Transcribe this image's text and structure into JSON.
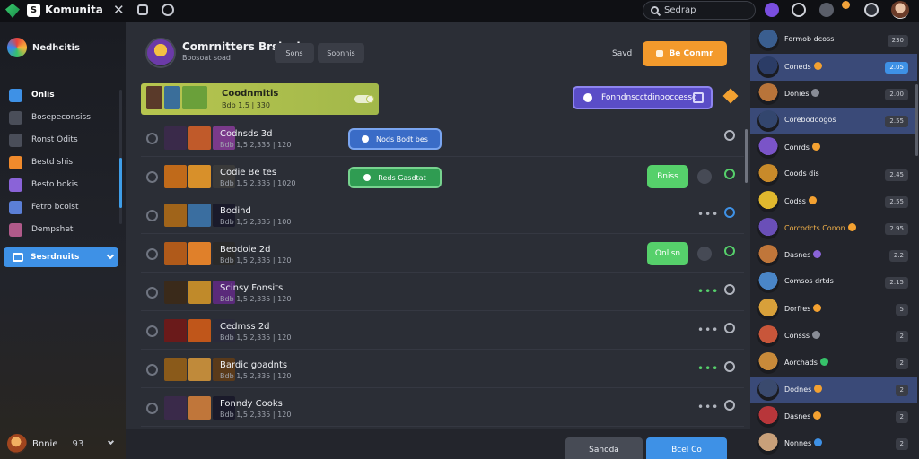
{
  "titlebar": {
    "title": "Komunita",
    "search_placeholder": "Sedrap"
  },
  "sidebar": {
    "title": "Nedhcitis",
    "items": [
      {
        "label": "Onlis",
        "icon": "chat-icon",
        "color": "#3e91e6"
      },
      {
        "label": "Bosepeconsiss",
        "icon": "grid-icon",
        "color": "#4a4e59"
      },
      {
        "label": "Ronst Odits",
        "icon": "document-icon",
        "color": "#4a4e59"
      },
      {
        "label": "Bestd shis",
        "icon": "fire-icon",
        "color": "#f08a2c"
      },
      {
        "label": "Besto bokis",
        "icon": "gamepad-icon",
        "color": "#8a63d8"
      },
      {
        "label": "Fetro bcoist",
        "icon": "image-icon",
        "color": "#5b7fd6"
      },
      {
        "label": "Dempshet",
        "icon": "globe-icon",
        "color": "#b05a8a"
      }
    ],
    "select_label": "Sesrdnuits",
    "user_name": "Bnnie",
    "user_num": "93"
  },
  "main": {
    "header_title": "Comrnitters Brsked",
    "header_sub": "Boosoat soad",
    "pill_1": "Sons",
    "pill_2": "Soonnis",
    "save_label": "Savd",
    "primary_label": "Be Conmr"
  },
  "featured": {
    "title": "Coodnmitis",
    "meta": "Bdb 1,5 | 330",
    "action_label": "Fonndnscctdinooccessd"
  },
  "rows": [
    {
      "title": "Codnsds 3d",
      "meta": "Bdb 1,5 2,335 | 120",
      "pill": {
        "label": "Nods Bodt bes",
        "type": "blue"
      },
      "status": null,
      "trail": "none",
      "end": "grey"
    },
    {
      "title": "Codie Be tes",
      "meta": "Bdb 1,5 2,335 | 1020",
      "pill": {
        "label": "Reds Gasdtat",
        "type": "green"
      },
      "status": "Bniss",
      "trail": "add",
      "end": "green"
    },
    {
      "title": "Bodind",
      "meta": "Bdb 1,5 2,335 | 100",
      "pill": null,
      "status": null,
      "trail": "dots-grey",
      "end": "blue"
    },
    {
      "title": "Beodoie 2d",
      "meta": "Bdb 1,5 2,335 | 120",
      "pill": null,
      "status": "Onlisn",
      "trail": "add",
      "end": "green"
    },
    {
      "title": "Scinsy Fonsits",
      "meta": "Bdb 1,5 2,335 | 120",
      "pill": null,
      "status": null,
      "trail": "dots-green",
      "end": "grey"
    },
    {
      "title": "Cedmss 2d",
      "meta": "Bdb 1,5 2,335 | 120",
      "pill": null,
      "status": null,
      "trail": "dots-grey",
      "end": "grey"
    },
    {
      "title": "Bardic goadnts",
      "meta": "Bdb 1,5 2,335 | 120",
      "pill": null,
      "status": null,
      "trail": "dots-green",
      "end": "grey"
    },
    {
      "title": "Fonndy Cooks",
      "meta": "Bdb 1,5 2,335 | 120",
      "pill": null,
      "status": null,
      "trail": "dots-grey",
      "end": "grey"
    }
  ],
  "footer": {
    "secondary_label": "Sanoda",
    "primary_label": "Bcel Co"
  },
  "members": [
    {
      "name": "Formob dcoss",
      "tag": "230",
      "dot": null,
      "highlight": false,
      "orange": false,
      "avatar": "#3a5e8f"
    },
    {
      "name": "Coneds",
      "tag": "2.05",
      "dot": "#f3a131",
      "highlight": true,
      "orange": false,
      "avatar": "#2b3c66",
      "tag_blue": true
    },
    {
      "name": "Donies",
      "tag": "2.00",
      "dot": "#888c96",
      "highlight": false,
      "orange": false,
      "avatar": "#b8743a"
    },
    {
      "name": "Corebodoogos",
      "tag": "2.55",
      "dot": null,
      "highlight": true,
      "orange": false,
      "avatar": "#33466e"
    },
    {
      "name": "Conrds",
      "tag": "",
      "dot": "#f3a131",
      "highlight": false,
      "orange": false,
      "avatar": "#7a54c8"
    },
    {
      "name": "Coods dis",
      "tag": "2.45",
      "dot": null,
      "highlight": false,
      "orange": false,
      "avatar": "#c88a2a"
    },
    {
      "name": "Codss",
      "tag": "2.55",
      "dot": "#f3a131",
      "highlight": false,
      "orange": false,
      "avatar": "#e0b82e"
    },
    {
      "name": "Corcodcts Conon",
      "tag": "2.95",
      "dot": "#f3a131",
      "highlight": false,
      "orange": true,
      "avatar": "#6a4fb8"
    },
    {
      "name": "Dasnes",
      "tag": "2.2",
      "dot": "#8a63d8",
      "highlight": false,
      "orange": false,
      "avatar": "#c0763a"
    },
    {
      "name": "Comsos drtds",
      "tag": "2.15",
      "dot": null,
      "highlight": false,
      "orange": false,
      "avatar": "#4a86c8"
    },
    {
      "name": "Dorfres",
      "tag": "5",
      "dot": "#f3a131",
      "highlight": false,
      "orange": false,
      "avatar": "#d8a03a"
    },
    {
      "name": "Consss",
      "tag": "2",
      "dot": "#888c96",
      "highlight": false,
      "orange": false,
      "avatar": "#c8563a"
    },
    {
      "name": "Aorchads",
      "tag": "2",
      "dot": "#36c26a",
      "highlight": false,
      "orange": false,
      "avatar": "#c88a3a"
    },
    {
      "name": "Dodnes",
      "tag": "2",
      "dot": "#f3a131",
      "highlight": true,
      "orange": false,
      "avatar": "#3a4a6e"
    },
    {
      "name": "Dasnes",
      "tag": "2",
      "dot": "#f3a131",
      "highlight": false,
      "orange": false,
      "avatar": "#b8363a"
    },
    {
      "name": "Nonnes",
      "tag": "2",
      "dot": "#3e91e6",
      "highlight": false,
      "orange": false,
      "avatar": "#c8a07a"
    }
  ],
  "colors": {
    "accent_blue": "#3e91e6",
    "accent_orange": "#f39a2c",
    "accent_green": "#56d06b",
    "accent_purple": "#5a4dc7",
    "featured_bg": "#b7c54f"
  }
}
